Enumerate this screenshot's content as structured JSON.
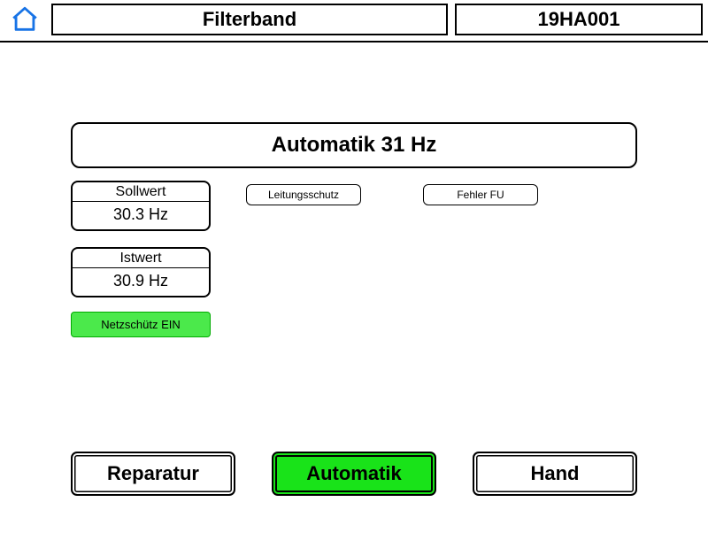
{
  "header": {
    "title": "Filterband",
    "code": "19HA001"
  },
  "status": {
    "text": "Automatik 31 Hz"
  },
  "sollwert": {
    "label": "Sollwert",
    "value": "30.3 Hz"
  },
  "istwert": {
    "label": "Istwert",
    "value": "30.9 Hz"
  },
  "buttons": {
    "leitungsschutz": "Leitungsschutz",
    "fehler_fu": "Fehler FU",
    "netzschuetz": "Netzschütz EIN"
  },
  "modes": {
    "reparatur": "Reparatur",
    "automatik": "Automatik",
    "hand": "Hand"
  }
}
